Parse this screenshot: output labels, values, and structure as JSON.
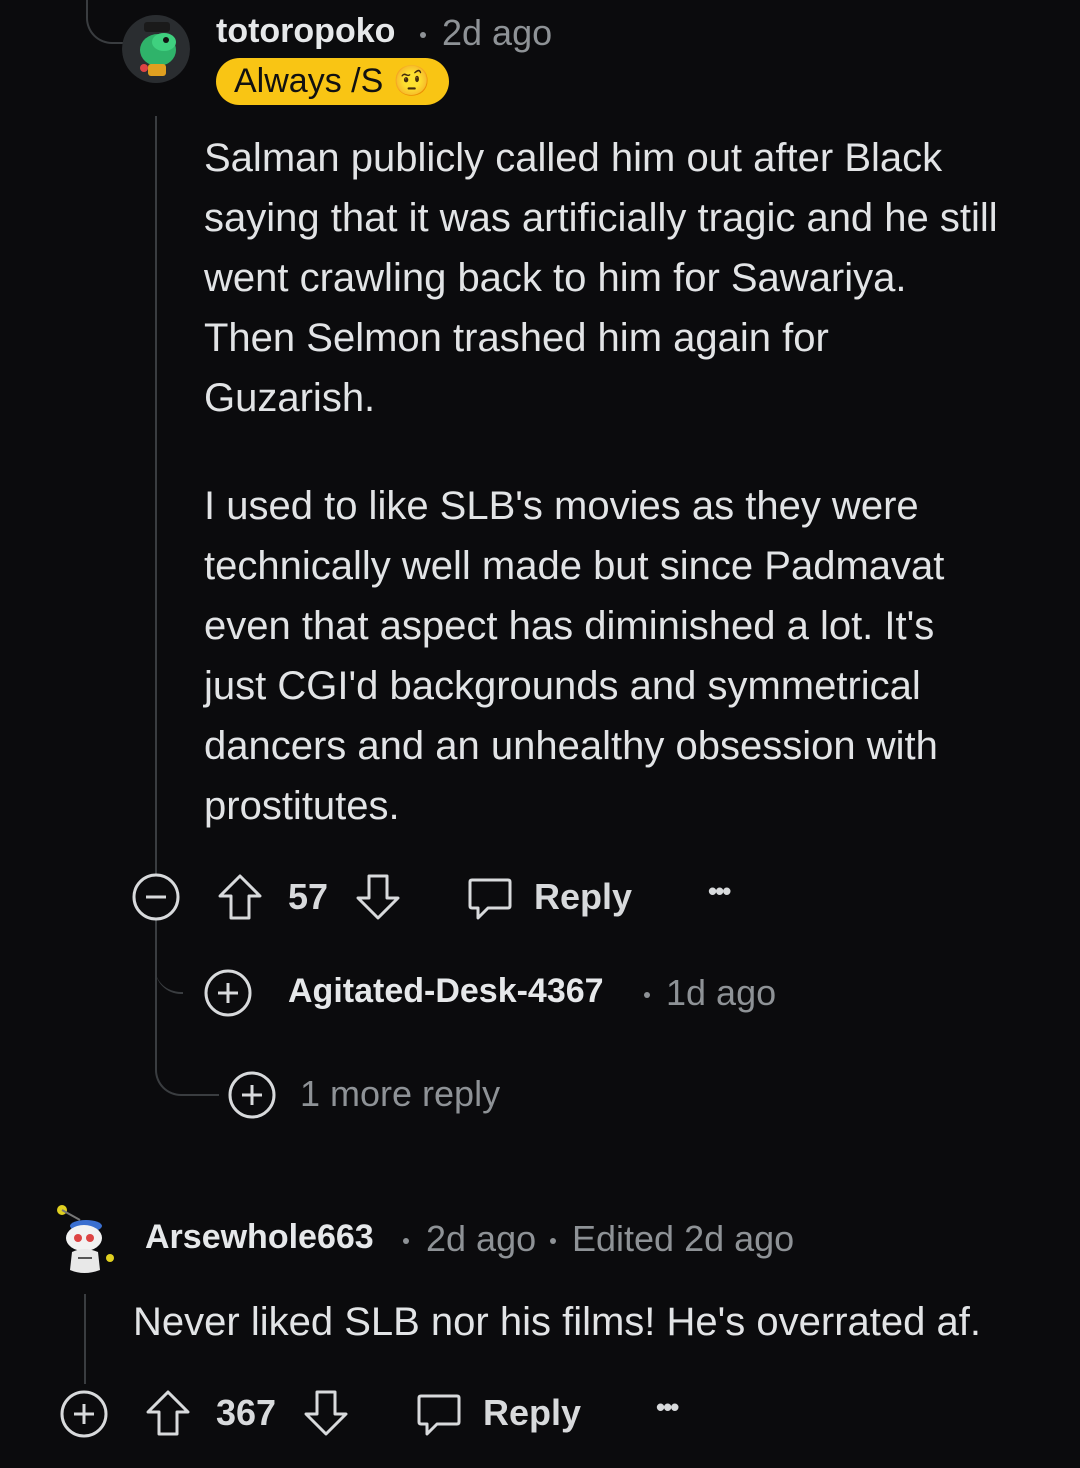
{
  "comment1": {
    "username": "totoropoko",
    "time": "2d ago",
    "flair": "Always /S",
    "flair_emoji": "🤨",
    "paragraphs": [
      "Salman publicly called him out after Black saying that it was artificially tragic and he still went crawling back to him for Sawariya. Then Selmon trashed him again for Guzarish.",
      "I used to like SLB's movies as they were technically well made but since Padmavat even that aspect has diminished a lot. It's just CGI'd backgrounds and symmetrical dancers and an unhealthy obsession with prostitutes."
    ],
    "votes": "57",
    "reply_label": "Reply",
    "more_label": "•••"
  },
  "reply1": {
    "username": "Agitated-Desk-4367",
    "time": "1d ago"
  },
  "more_replies": {
    "label": "1 more reply"
  },
  "comment2": {
    "username": "Arsewhole663",
    "time": "2d ago",
    "edited": "Edited 2d ago",
    "text": "Never liked SLB nor his films! He's overrated af.",
    "votes": "367",
    "reply_label": "Reply",
    "more_label": "•••"
  },
  "icons": {
    "collapse": "minus-circle-icon",
    "expand": "plus-circle-icon",
    "upvote": "arrow-up-icon",
    "downvote": "arrow-down-icon",
    "reply": "speech-bubble-icon",
    "more": "ellipsis-icon"
  },
  "colors": {
    "background": "#0b0b0d",
    "flair": "#f9c514",
    "muted": "#8e9296",
    "text": "#e2e4e6"
  }
}
